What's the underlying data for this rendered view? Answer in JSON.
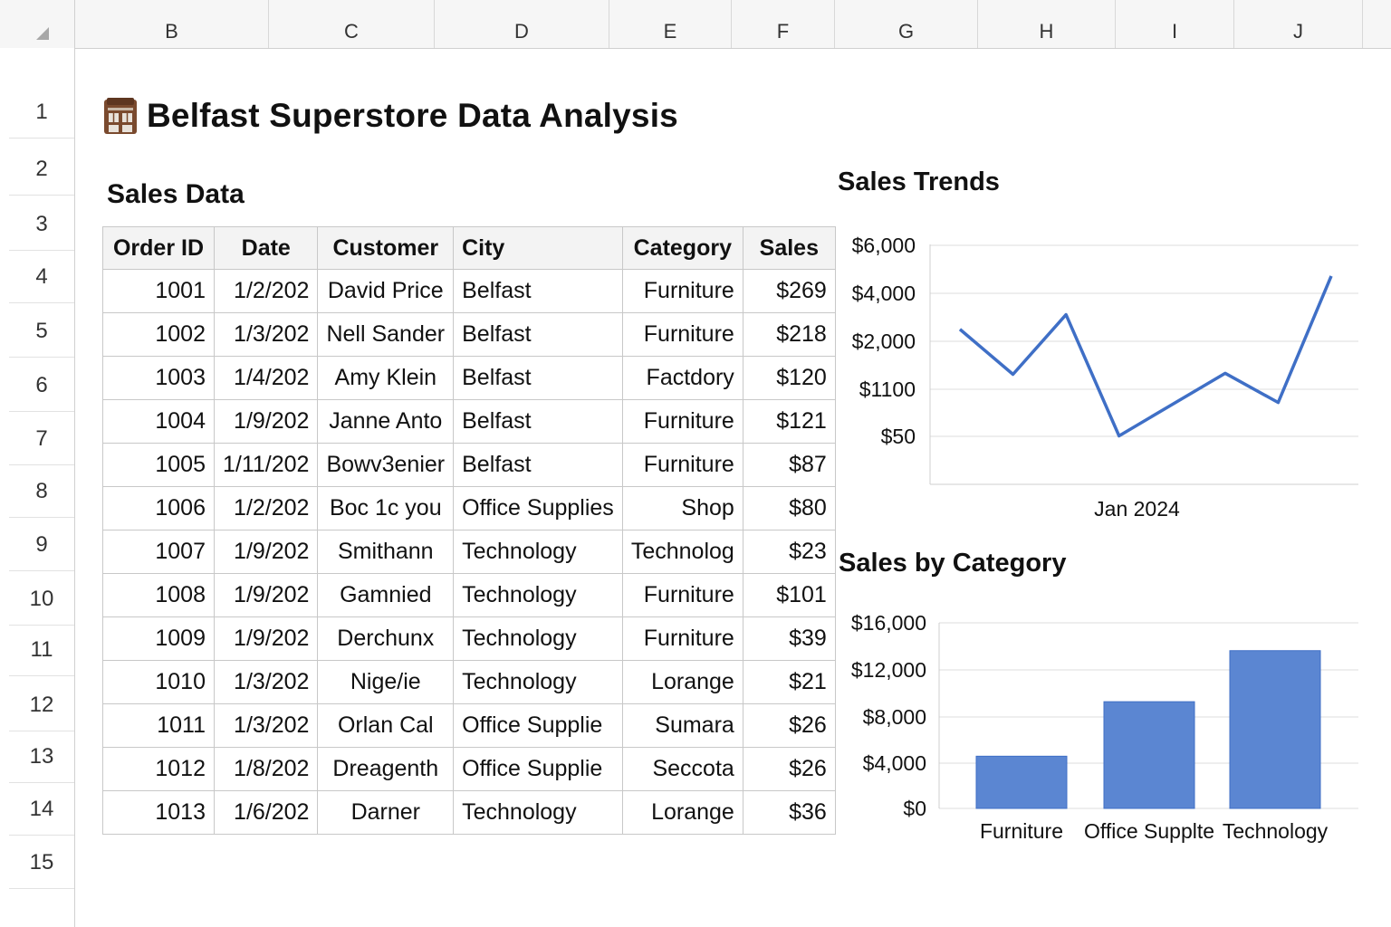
{
  "column_headers": [
    "B",
    "C",
    "D",
    "E",
    "F",
    "G",
    "H",
    "I",
    "J"
  ],
  "row_numbers": [
    "1",
    "2",
    "3",
    "4",
    "5",
    "6",
    "7",
    "8",
    "9",
    "10",
    "11",
    "12",
    "13",
    "14",
    "15"
  ],
  "title": {
    "icon": "storefront-icon",
    "text": "Belfast Superstore Data Analysis"
  },
  "sales_data": {
    "title": "Sales Data",
    "headers": [
      "Order ID",
      "Date",
      "Customer",
      "City",
      "Category",
      "Sales"
    ],
    "rows": [
      [
        "1001",
        "1/2/202",
        "David Price",
        "Belfast",
        "Furniture",
        "$269"
      ],
      [
        "1002",
        "1/3/202",
        "Nell Sander",
        "Belfast",
        "Furniture",
        "$218"
      ],
      [
        "1003",
        "1/4/202",
        "Amy Klein",
        "Belfast",
        "Factdory",
        "$120"
      ],
      [
        "1004",
        "1/9/202",
        "Janne Anto",
        "Belfast",
        "Furniture",
        "$121"
      ],
      [
        "1005",
        "1/11/202",
        "Bowv3enier",
        "Belfast",
        "Furniture",
        "$87"
      ],
      [
        "1006",
        "1/2/202",
        "Boc 1c you",
        "Office Supplies",
        "Shop",
        "$80"
      ],
      [
        "1007",
        "1/9/202",
        "Smithann",
        "Technology",
        "Technolog",
        "$23"
      ],
      [
        "1008",
        "1/9/202",
        "Gamnied",
        "Technology",
        "Furniture",
        "$101"
      ],
      [
        "1009",
        "1/9/202",
        "Derchunx",
        "Technology",
        "Furniture",
        "$39"
      ],
      [
        "1010",
        "1/3/202",
        "Nige/ie",
        "Technology",
        "Lorange",
        "$21"
      ],
      [
        "1011",
        "1/3/202",
        "Orlan Cal",
        "Office Supplie",
        "Sumara",
        "$26"
      ],
      [
        "1012",
        "1/8/202",
        "Dreagenth",
        "Office Supplie",
        "Seccota",
        "$26"
      ],
      [
        "1013",
        "1/6/202",
        "Darner",
        "Technology",
        "Lorange",
        "$36"
      ]
    ]
  },
  "chart_data": [
    {
      "type": "line",
      "title": "Sales Trends",
      "xlabel": "Jan 2024",
      "ylabel": "",
      "y_tick_labels": [
        "$6,000",
        "$4,000",
        "$2,000",
        "$1100",
        "$50"
      ],
      "y_ticks": [
        6000,
        4000,
        2000,
        1100,
        50
      ],
      "series": [
        {
          "values": [
            2500,
            1380,
            3110,
            60,
            760,
            1400,
            805,
            4720
          ]
        }
      ],
      "color": "#3f6fc6",
      "grid": true
    },
    {
      "type": "bar",
      "title": "Sales by Category",
      "categories": [
        "Furniture",
        "Office Supplte",
        "Technology"
      ],
      "values": [
        4500,
        9200,
        13600
      ],
      "ylim": [
        0,
        16000
      ],
      "y_tick_labels": [
        "$16,000",
        "$12,000",
        "$8,000",
        "$4,000",
        "$0"
      ],
      "y_ticks": [
        16000,
        12000,
        8000,
        4000,
        0
      ],
      "color": "#5b86d2",
      "grid": true
    }
  ]
}
